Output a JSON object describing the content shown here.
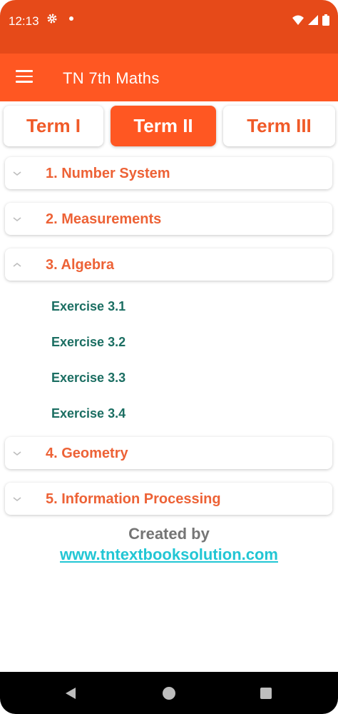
{
  "status_bar": {
    "time": "12:13",
    "icons": [
      "gear-icon",
      "notification-dot-icon",
      "wifi-icon",
      "cell-signal-icon",
      "battery-icon"
    ]
  },
  "app_bar": {
    "title": "TN 7th Maths",
    "menu_icon": "hamburger-menu-icon"
  },
  "tabs": [
    {
      "label": "Term I",
      "active": false
    },
    {
      "label": "Term II",
      "active": true
    },
    {
      "label": "Term III",
      "active": false
    }
  ],
  "chapters": [
    {
      "label": "1. Number System",
      "expanded": false
    },
    {
      "label": "2. Measurements",
      "expanded": false
    },
    {
      "label": "3. Algebra",
      "expanded": true,
      "exercises": [
        "Exercise 3.1",
        "Exercise 3.2",
        "Exercise 3.3",
        "Exercise 3.4"
      ]
    },
    {
      "label": "4. Geometry",
      "expanded": false
    },
    {
      "label": "5. Information Processing",
      "expanded": false
    }
  ],
  "credit": {
    "title": "Created by",
    "link": "www.tntextbooksolution.com"
  },
  "colors": {
    "status_bar": "#e64a19",
    "app_bar": "#ff5722",
    "accent_text": "#ed6236",
    "exercise_text": "#1b6e62",
    "link": "#22c6d4"
  },
  "nav_bar": {
    "icons": [
      "back-icon",
      "home-icon",
      "recents-icon"
    ]
  }
}
